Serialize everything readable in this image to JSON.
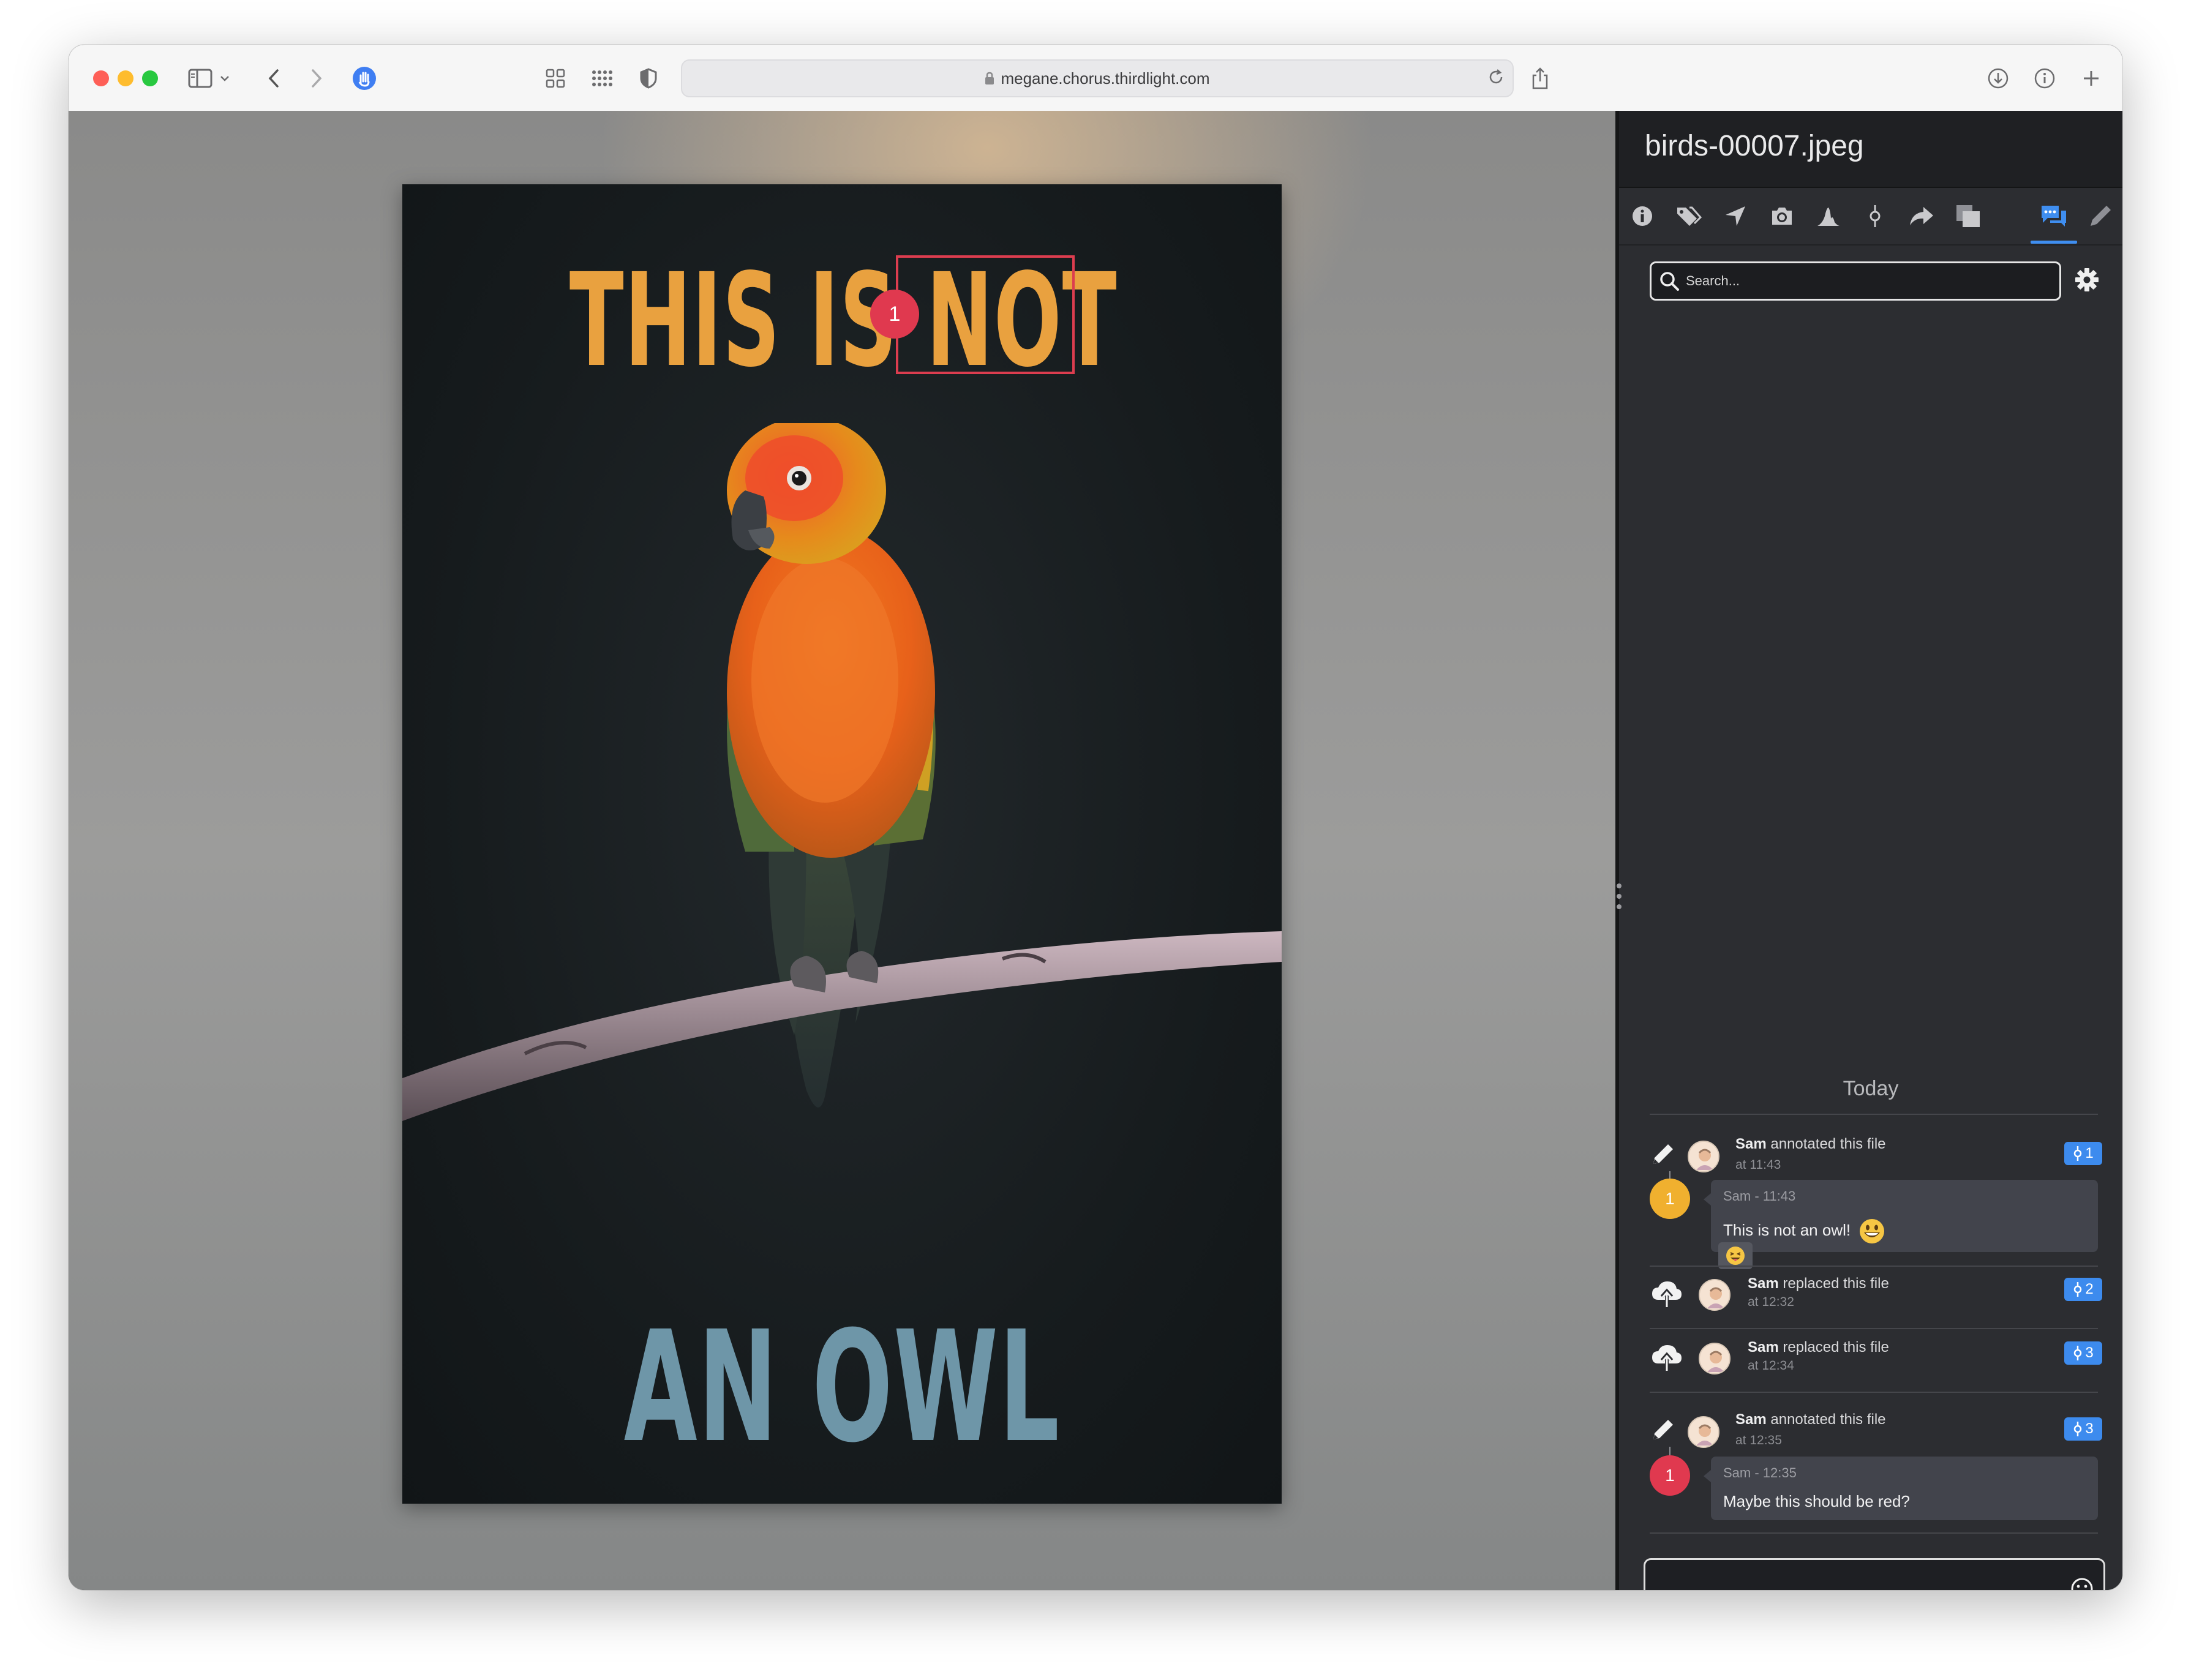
{
  "browser": {
    "url": "megane.chorus.thirdlight.com"
  },
  "viewer": {
    "headline_top": "THIS IS NOT",
    "headline_bottom": "AN OWL",
    "annotation_marker": "1"
  },
  "sidebar": {
    "file_title": "birds-00007.jpeg",
    "tabs": [
      "info",
      "tags",
      "location",
      "camera",
      "histogram",
      "versions",
      "share",
      "duplicates",
      "comments",
      "annotate"
    ],
    "active_tab": "comments",
    "search_placeholder": "Search...",
    "today_label": "Today",
    "events": [
      {
        "user": "Sam",
        "action": "annotated this file",
        "time": "at 11:43",
        "version": "1"
      },
      {
        "user": "Sam",
        "action": "replaced this file",
        "time": "at 12:32",
        "version": "2"
      },
      {
        "user": "Sam",
        "action": "replaced this file",
        "time": "at 12:34",
        "version": "3"
      },
      {
        "user": "Sam",
        "action": "annotated this file",
        "time": "at 12:35",
        "version": "3"
      }
    ],
    "comments": [
      {
        "marker": "1",
        "marker_color": "#f0b02f",
        "meta": "Sam - 11:43",
        "text": "This is not an owl!"
      },
      {
        "marker": "1",
        "marker_color": "#e0394f",
        "meta": "Sam - 12:35",
        "text": "Maybe this should be red?"
      }
    ]
  },
  "colors": {
    "accent": "#3d8bee",
    "annotation_red": "#dc3d4f",
    "headline_orange": "#e9a13f",
    "headline_blue": "#6e96a8"
  }
}
